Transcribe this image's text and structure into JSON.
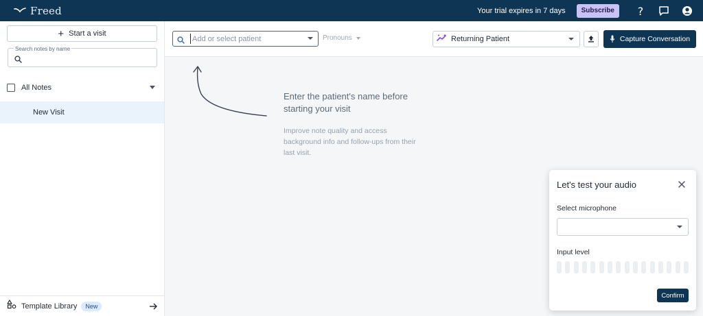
{
  "app": {
    "brand_name": "Freed",
    "trial_text": "Your trial expires in 7 days",
    "subscribe_label": "Subscribe",
    "icons": {
      "help": "help-icon",
      "chat": "chat-icon",
      "account": "account-icon"
    }
  },
  "sidebar": {
    "start_visit_label": "Start a visit",
    "search_label": "Search notes by name",
    "search_value": "",
    "all_notes_label": "All Notes",
    "items": [
      {
        "label": "New Visit",
        "selected": true
      }
    ],
    "template_library_label": "Template Library",
    "template_library_badge": "New"
  },
  "toolbar": {
    "patient_placeholder": "Add or select patient",
    "patient_value": "",
    "pronouns_label": "Pronouns",
    "visit_type_label": "Returning Patient",
    "capture_label": "Capture Conversation"
  },
  "empty_state": {
    "title": "Enter the patient's name before starting your visit",
    "body": "Improve note quality and access background info and follow-ups from their last visit."
  },
  "audio_dialog": {
    "title": "Let's test your audio",
    "mic_label": "Select microphone",
    "mic_value": "",
    "input_level_label": "Input level",
    "level_bar_count": 16,
    "input_level": 0,
    "confirm_label": "Confirm"
  },
  "colors": {
    "brand_navy": "#0f3554",
    "subscribe_bg": "#c9c3f5",
    "selected_row": "#eaf3fb",
    "focus_blue": "#2f6fb0",
    "visit_type_accent": "#7c4ddb"
  }
}
